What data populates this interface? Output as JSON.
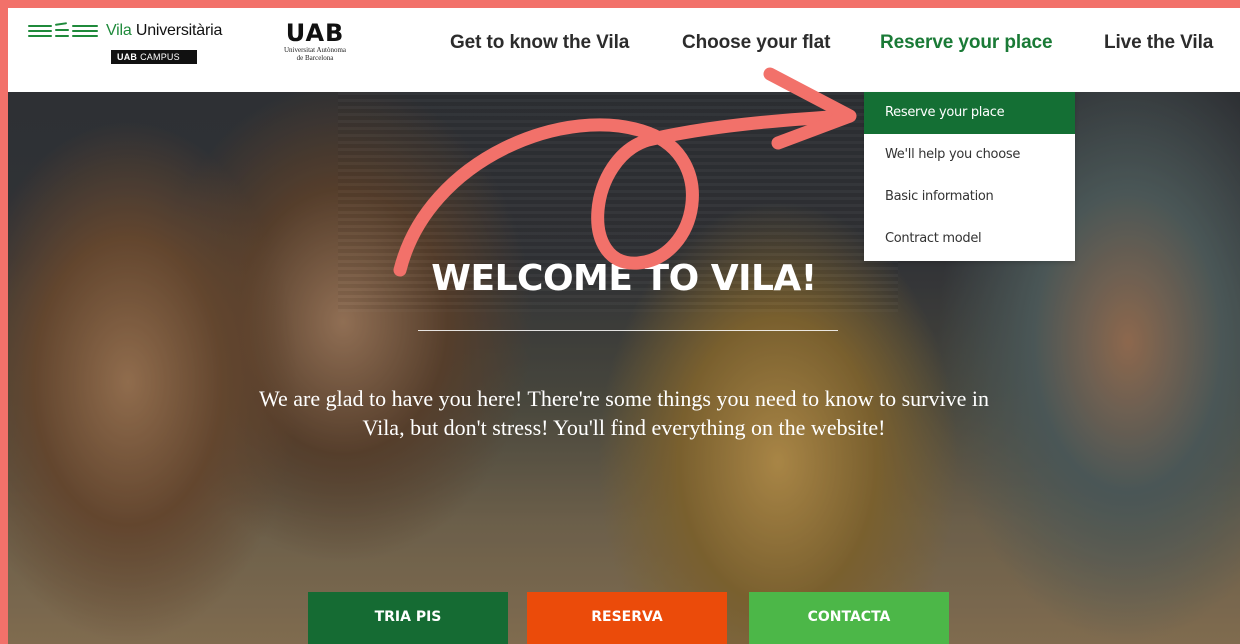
{
  "brand": {
    "vila_prefix": "Vila",
    "vila_suffix": " Universitària",
    "campus_bold": "UAB",
    "campus_text": "CAMPUS",
    "uab_mark": "UAB",
    "uab_sub_line1": "Universitat Autònoma",
    "uab_sub_line2": "de Barcelona"
  },
  "nav": {
    "items": [
      {
        "label": "Get to know the Vila",
        "active": false
      },
      {
        "label": "Choose your flat",
        "active": false
      },
      {
        "label": "Reserve your place",
        "active": true
      },
      {
        "label": "Live the Vila",
        "active": false
      }
    ]
  },
  "dropdown": {
    "items": [
      {
        "label": "Reserve your place",
        "active": true
      },
      {
        "label": "We'll help you choose",
        "active": false
      },
      {
        "label": "Basic information",
        "active": false
      },
      {
        "label": "Contract model",
        "active": false
      }
    ]
  },
  "hero": {
    "title": "WELCOME TO VILA!",
    "text_line1": "We are glad to have you here! There're some things you need to know to survive in",
    "text_line2": "Vila, but don't stress! You'll find everything on the website!"
  },
  "cta": {
    "buttons": [
      {
        "label": "TRIA PIS",
        "color": "#156b33"
      },
      {
        "label": "RESERVA",
        "color": "#eb4b0a"
      },
      {
        "label": "CONTACTA",
        "color": "#4cb748"
      }
    ]
  },
  "colors": {
    "frame": "#f2716a",
    "brand_green": "#1a7a36",
    "annotation_arrow": "#f2716a"
  },
  "icons": {
    "logo": "vila-lines-logo-icon",
    "annotation": "curly-arrow-annotation-icon"
  }
}
